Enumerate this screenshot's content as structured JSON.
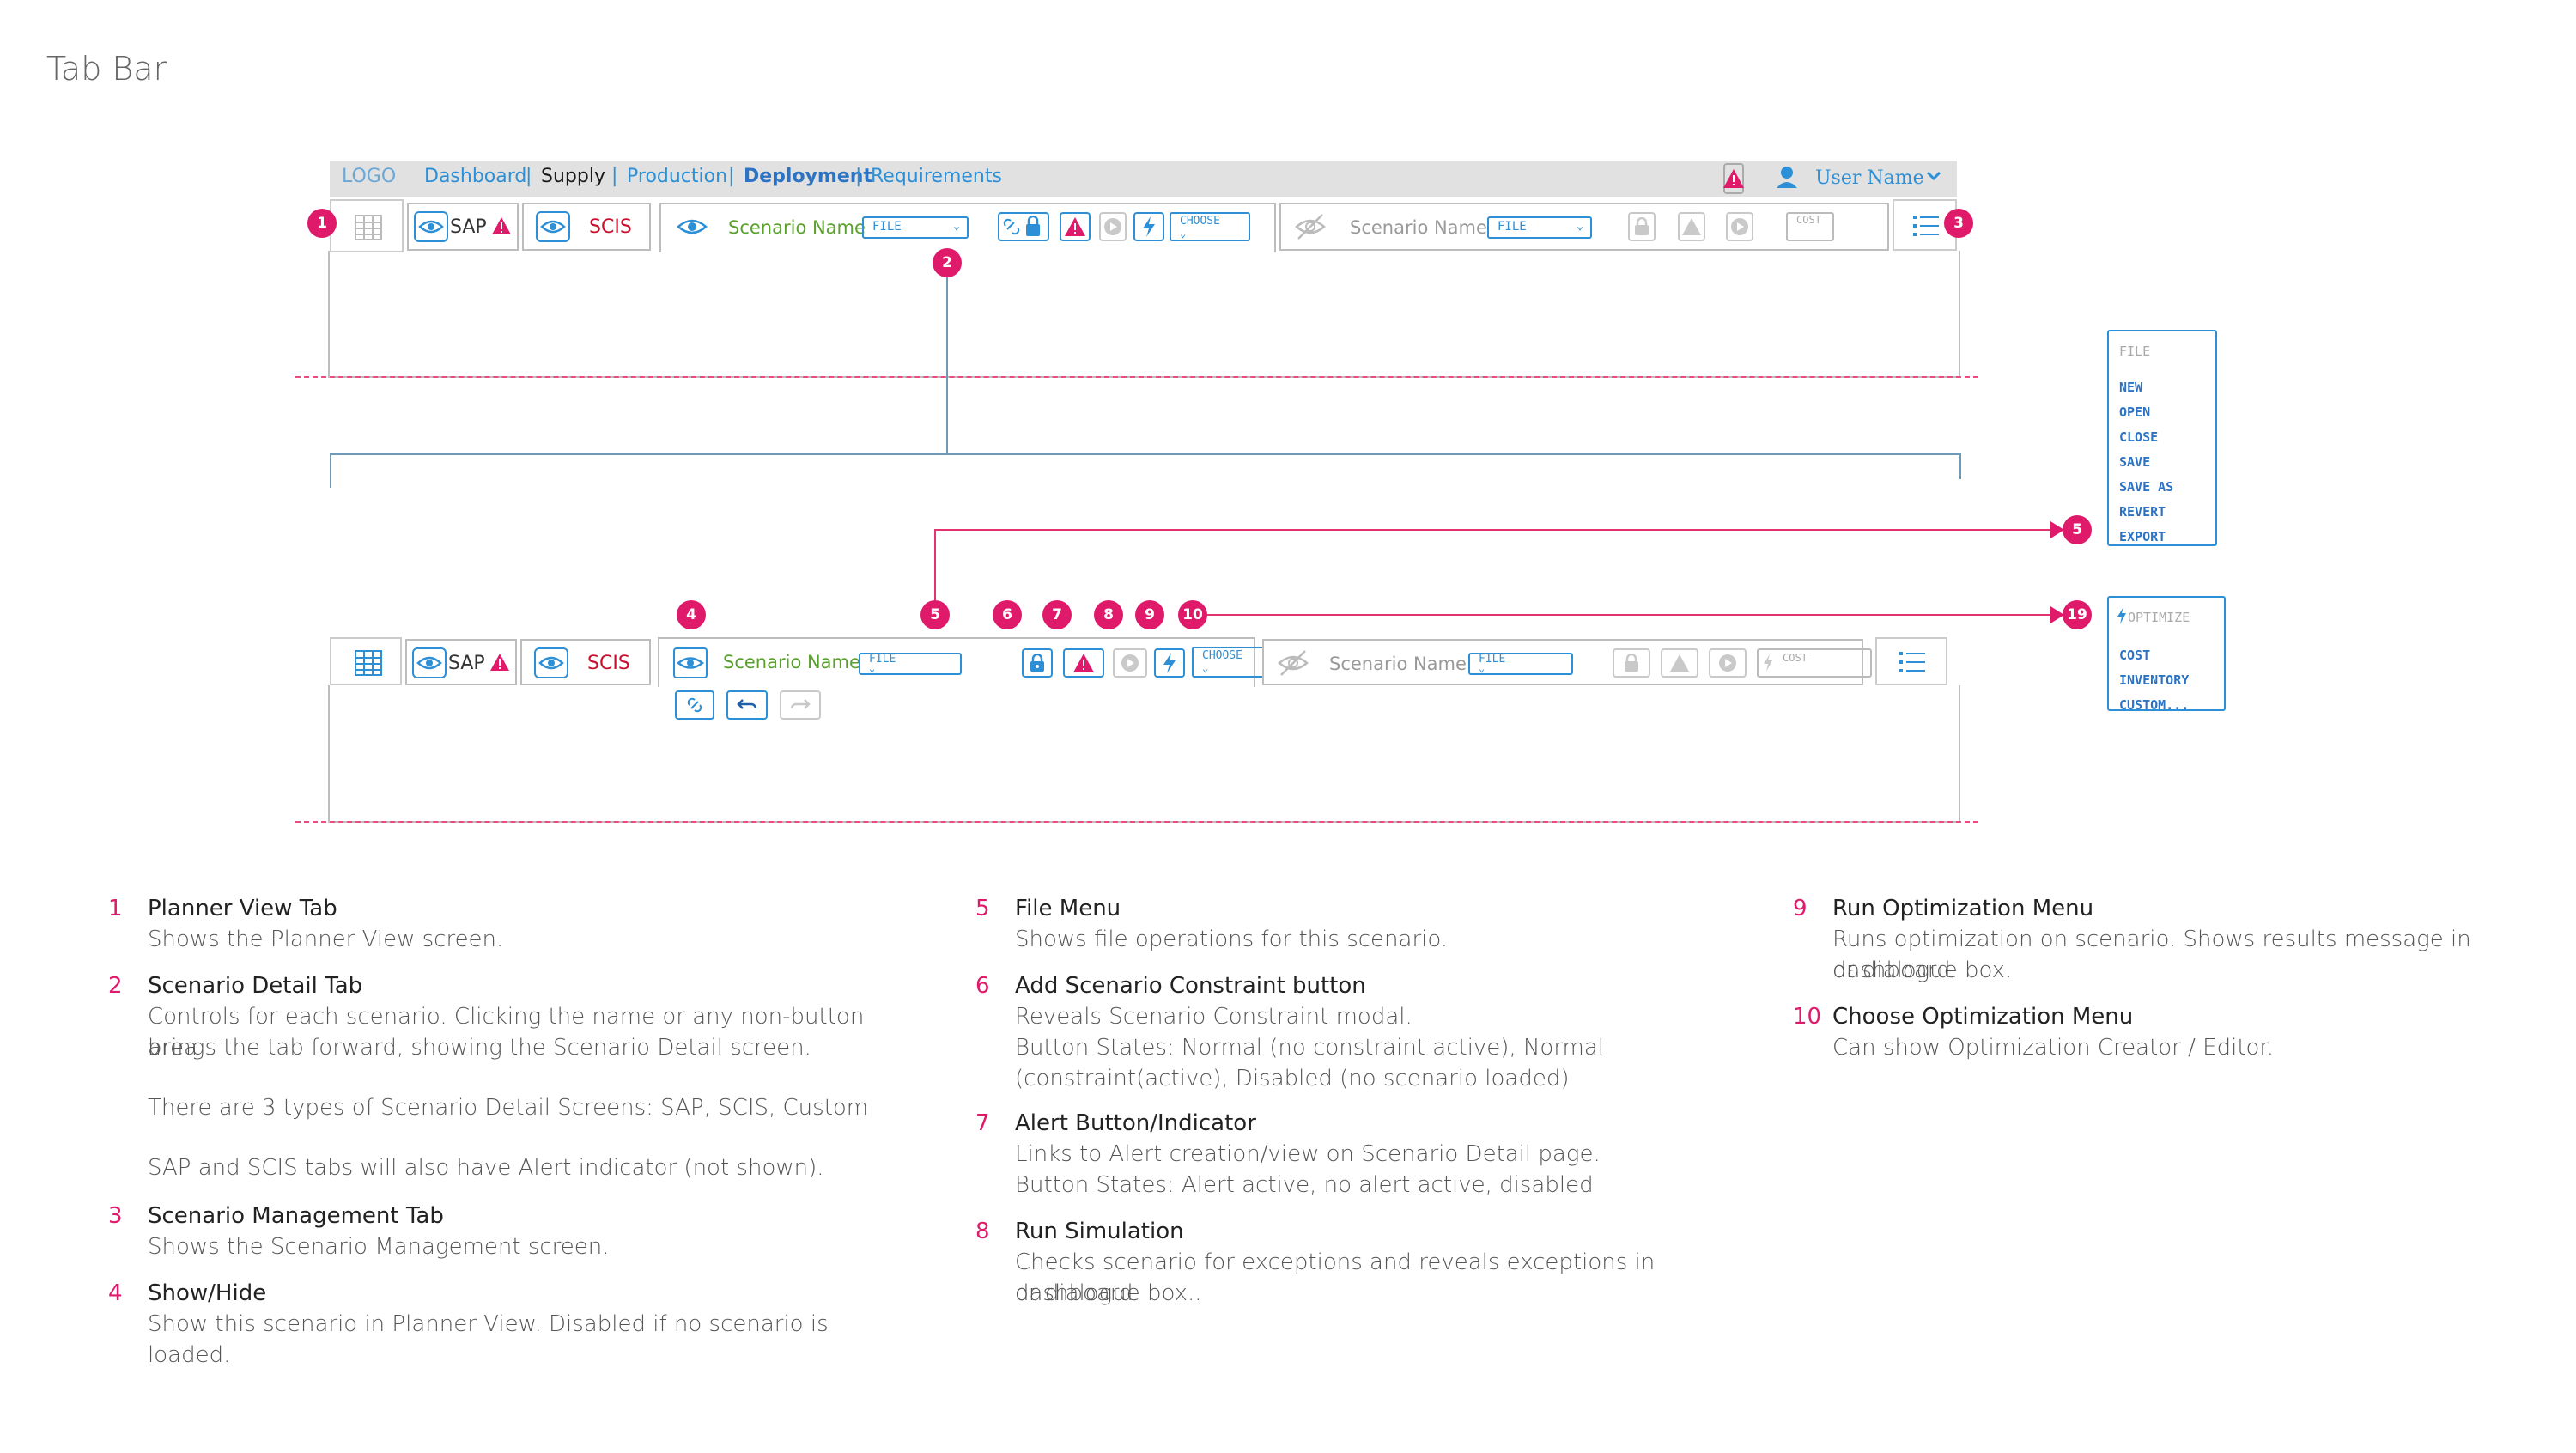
{
  "page_title": "Tab Bar",
  "header": {
    "logo": "LOGO",
    "nav": [
      "Dashboard",
      "Supply",
      "Production",
      "Deployment",
      "Requirements"
    ],
    "separator": "|",
    "user_name": "User Name"
  },
  "tabs": {
    "sap": "SAP",
    "scis": "SCIS",
    "scenario_name": "Scenario Name",
    "file": "FILE",
    "choose": "CHOOSE",
    "cost": "COST"
  },
  "badges": [
    "1",
    "2",
    "3",
    "4",
    "5",
    "6",
    "7",
    "8",
    "9",
    "10",
    "19"
  ],
  "file_menu": {
    "title": "FILE",
    "items": [
      "NEW",
      "OPEN",
      "CLOSE",
      "SAVE",
      "SAVE AS",
      "REVERT",
      "EXPORT"
    ]
  },
  "optimize_menu": {
    "title": "OPTIMIZE",
    "items": [
      "COST",
      "INVENTORY",
      "CUSTOM..."
    ]
  },
  "descriptions": [
    {
      "num": "1",
      "title": "Planner View Tab",
      "text": "Shows the Planner View screen."
    },
    {
      "num": "2",
      "title": "Scenario Detail Tab",
      "lines": [
        "Controls for each scenario. Clicking the name or any non-button area",
        "brings the tab forward, showing the Scenario Detail screen.",
        "",
        "There are 3 types of Scenario Detail Screens: SAP, SCIS, Custom",
        "",
        "SAP and SCIS tabs will also have Alert indicator (not shown)."
      ]
    },
    {
      "num": "3",
      "title": "Scenario Management Tab",
      "text": "Shows the Scenario Management screen."
    },
    {
      "num": "4",
      "title": "Show/Hide",
      "text": "Show this scenario in Planner View. Disabled if no scenario is loaded."
    },
    {
      "num": "5",
      "title": "File Menu",
      "text": "Shows file operations for this scenario."
    },
    {
      "num": "6",
      "title": "Add Scenario Constraint button",
      "lines": [
        "Reveals Scenario Constraint modal.",
        "Button States: Normal (no constraint active), Normal",
        "(constraint(active), Disabled (no scenario loaded)"
      ]
    },
    {
      "num": "7",
      "title": "Alert Button/Indicator",
      "lines": [
        "Links to Alert creation/view on Scenario Detail page.",
        "Button States: Alert active, no alert active, disabled"
      ]
    },
    {
      "num": "8",
      "title": "Run Simulation",
      "lines": [
        "Checks scenario for exceptions and reveals exceptions in dashboard",
        "or dialogue box.."
      ]
    },
    {
      "num": "9",
      "title": "Run Optimization Menu",
      "lines": [
        "Runs optimization on scenario. Shows results message in dashboard",
        "or dialogue box."
      ]
    },
    {
      "num": "10",
      "title": "Choose Optimization Menu",
      "text": "Can show Optimization Creator / Editor."
    }
  ],
  "colors": {
    "accent": "#2d8fd6",
    "badge": "#e01a6b",
    "alert": "#e01a6b",
    "scenario": "#5aa02c",
    "scis": "#c8102e"
  }
}
